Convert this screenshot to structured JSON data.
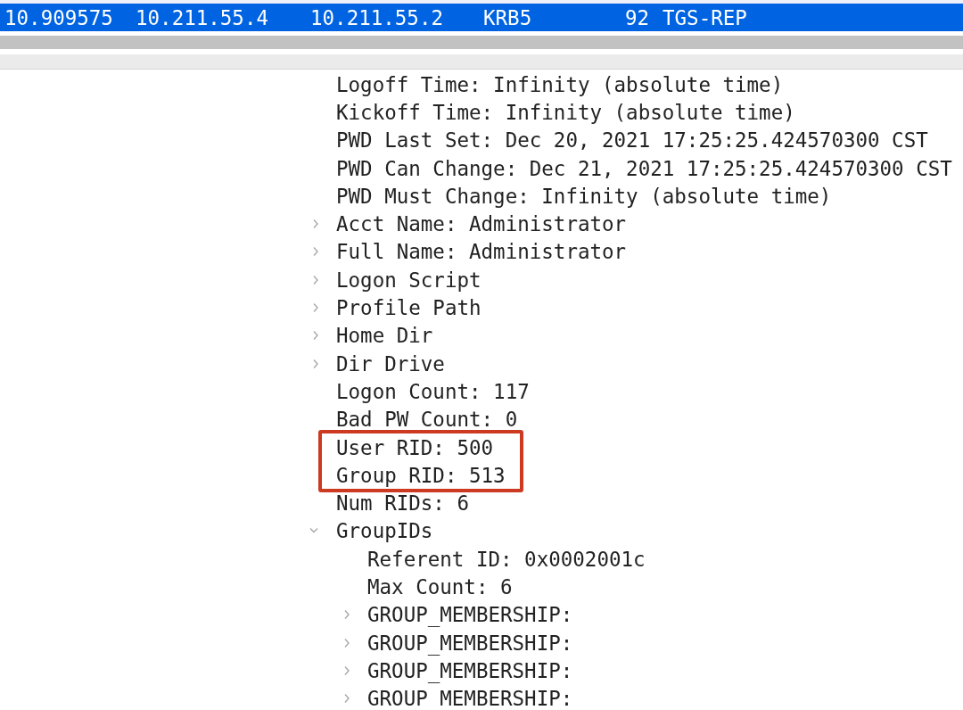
{
  "packet_row": {
    "selected": true,
    "time": "10.909575",
    "source": "10.211.55.4",
    "destination": "10.211.55.2",
    "protocol": "KRB5",
    "length": "92",
    "info": "TGS-REP"
  },
  "details": [
    {
      "kind": "leaf",
      "label": "Logoff Time: Infinity (absolute time)"
    },
    {
      "kind": "leaf",
      "label": "Kickoff Time: Infinity (absolute time)"
    },
    {
      "kind": "leaf",
      "label": "PWD Last Set: Dec 20, 2021 17:25:25.424570300 CST"
    },
    {
      "kind": "leaf",
      "label": "PWD Can Change: Dec 21, 2021 17:25:25.424570300 CST"
    },
    {
      "kind": "leaf",
      "label": "PWD Must Change: Infinity (absolute time)"
    },
    {
      "kind": "branch",
      "label": "Acct Name: Administrator",
      "expanded": false
    },
    {
      "kind": "branch",
      "label": "Full Name: Administrator",
      "expanded": false
    },
    {
      "kind": "branch",
      "label": "Logon Script",
      "expanded": false
    },
    {
      "kind": "branch",
      "label": "Profile Path",
      "expanded": false
    },
    {
      "kind": "branch",
      "label": "Home Dir",
      "expanded": false
    },
    {
      "kind": "branch",
      "label": "Dir Drive",
      "expanded": false
    },
    {
      "kind": "leaf",
      "label": "Logon Count: 117"
    },
    {
      "kind": "leaf",
      "label": "Bad PW Count: 0"
    },
    {
      "kind": "highlight_box",
      "items": [
        {
          "kind": "leaf",
          "label": "User RID: 500"
        },
        {
          "kind": "leaf",
          "label": "Group RID: 513"
        }
      ]
    },
    {
      "kind": "leaf",
      "label": "Num RIDs: 6"
    },
    {
      "kind": "branch",
      "label": "GroupIDs",
      "expanded": true,
      "children": [
        {
          "kind": "leaf",
          "label": "Referent ID: 0x0002001c"
        },
        {
          "kind": "leaf",
          "label": "Max Count: 6"
        },
        {
          "kind": "branch",
          "label": "GROUP_MEMBERSHIP:",
          "expanded": false
        },
        {
          "kind": "branch",
          "label": "GROUP_MEMBERSHIP:",
          "expanded": false
        },
        {
          "kind": "branch",
          "label": "GROUP_MEMBERSHIP:",
          "expanded": false
        },
        {
          "kind": "branch",
          "label": "GROUP_MEMBERSHIP:",
          "expanded": false
        }
      ]
    }
  ]
}
